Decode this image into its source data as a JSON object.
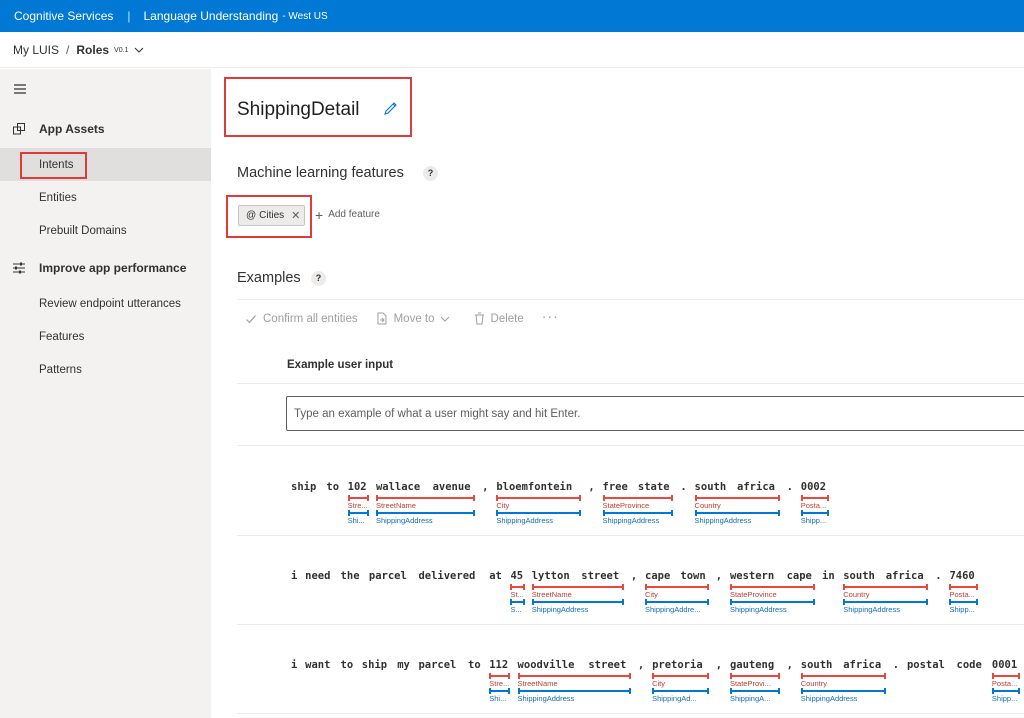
{
  "topbar": {
    "product": "Cognitive Services",
    "service": "Language Understanding",
    "region": "- West US"
  },
  "breadcrumb": {
    "root": "My LUIS",
    "app": "Roles",
    "version": "V0.1"
  },
  "sidebar": {
    "groups": [
      {
        "label": "App Assets",
        "icon": "app-assets-icon"
      },
      {
        "label": "Improve app performance",
        "icon": "sliders-icon"
      }
    ],
    "items": [
      {
        "label": "Intents",
        "active": true
      },
      {
        "label": "Entities"
      },
      {
        "label": "Prebuilt Domains"
      },
      {
        "label": "Review endpoint utterances"
      },
      {
        "label": "Features"
      },
      {
        "label": "Patterns"
      }
    ]
  },
  "main": {
    "intent_name": "ShippingDetail",
    "ml_features_title": "Machine learning features",
    "help_glyph": "?",
    "feature_chip": {
      "prefix": "@",
      "label": "Cities"
    },
    "add_feature_label": "Add feature",
    "examples_title": "Examples",
    "toolbar": {
      "confirm": "Confirm all entities",
      "move": "Move to",
      "delete": "Delete",
      "more": "···"
    },
    "column_header": "Example user input",
    "input_placeholder": "Type an example of what a user might say and hit Enter."
  },
  "utterances": [
    {
      "text": "ship to 102 wallace avenue , bloemfontein , free state . south africa . 0002",
      "tokens": [
        "ship",
        "to",
        "102",
        "wallace",
        "avenue",
        ",",
        "bloemfontein",
        ",",
        "free",
        "state",
        ".",
        "south",
        "africa",
        ".",
        "0002"
      ],
      "entities": [
        {
          "label": "Stre...",
          "role": "Shi...",
          "from": 2,
          "to": 2
        },
        {
          "label": "StreetName",
          "role": "ShippingAddress",
          "from": 3,
          "to": 4
        },
        {
          "label": "City",
          "role": "ShippingAddress",
          "from": 6,
          "to": 6
        },
        {
          "label": "StateProvince",
          "role": "ShippingAddress",
          "from": 8,
          "to": 9
        },
        {
          "label": "Country",
          "role": "ShippingAddress",
          "from": 11,
          "to": 12
        },
        {
          "label": "Posta...",
          "role": "Shipp...",
          "from": 14,
          "to": 14
        }
      ]
    },
    {
      "text": "i need the parcel delivered at 45 lytton street , cape town , western cape in south africa . 7460",
      "tokens": [
        "i",
        "need",
        "the",
        "parcel",
        "delivered",
        "at",
        "45",
        "lytton",
        "street",
        ",",
        "cape",
        "town",
        ",",
        "western",
        "cape",
        "in",
        "south",
        "africa",
        ".",
        "7460"
      ],
      "entities": [
        {
          "label": "St...",
          "role": "S...",
          "from": 6,
          "to": 6
        },
        {
          "label": "StreetName",
          "role": "ShippingAddress",
          "from": 7,
          "to": 8
        },
        {
          "label": "City",
          "role": "ShippingAddre...",
          "from": 10,
          "to": 11
        },
        {
          "label": "StateProvince",
          "role": "ShippingAddress",
          "from": 13,
          "to": 14
        },
        {
          "label": "Country",
          "role": "ShippingAddress",
          "from": 16,
          "to": 17
        },
        {
          "label": "Posta...",
          "role": "Shipp...",
          "from": 19,
          "to": 19
        }
      ]
    },
    {
      "text": "i want to ship my parcel to 112 woodville street , pretoria , gauteng , south africa . postal code 0001 .",
      "tokens": [
        "i",
        "want",
        "to",
        "ship",
        "my",
        "parcel",
        "to",
        "112",
        "woodville",
        "street",
        ",",
        "pretoria",
        ",",
        "gauteng",
        ",",
        "south",
        "africa",
        ".",
        "postal",
        "code",
        "0001",
        "."
      ],
      "entities": [
        {
          "label": "Stre...",
          "role": "Shi...",
          "from": 7,
          "to": 7
        },
        {
          "label": "StreetName",
          "role": "ShippingAddress",
          "from": 8,
          "to": 9
        },
        {
          "label": "City",
          "role": "ShippingAd...",
          "from": 11,
          "to": 11
        },
        {
          "label": "StateProvi...",
          "role": "ShippingA...",
          "from": 13,
          "to": 13
        },
        {
          "label": "Country",
          "role": "ShippingAddress",
          "from": 15,
          "to": 16
        },
        {
          "label": "Posta...",
          "role": "Shipp...",
          "from": 20,
          "to": 20
        }
      ]
    }
  ]
}
